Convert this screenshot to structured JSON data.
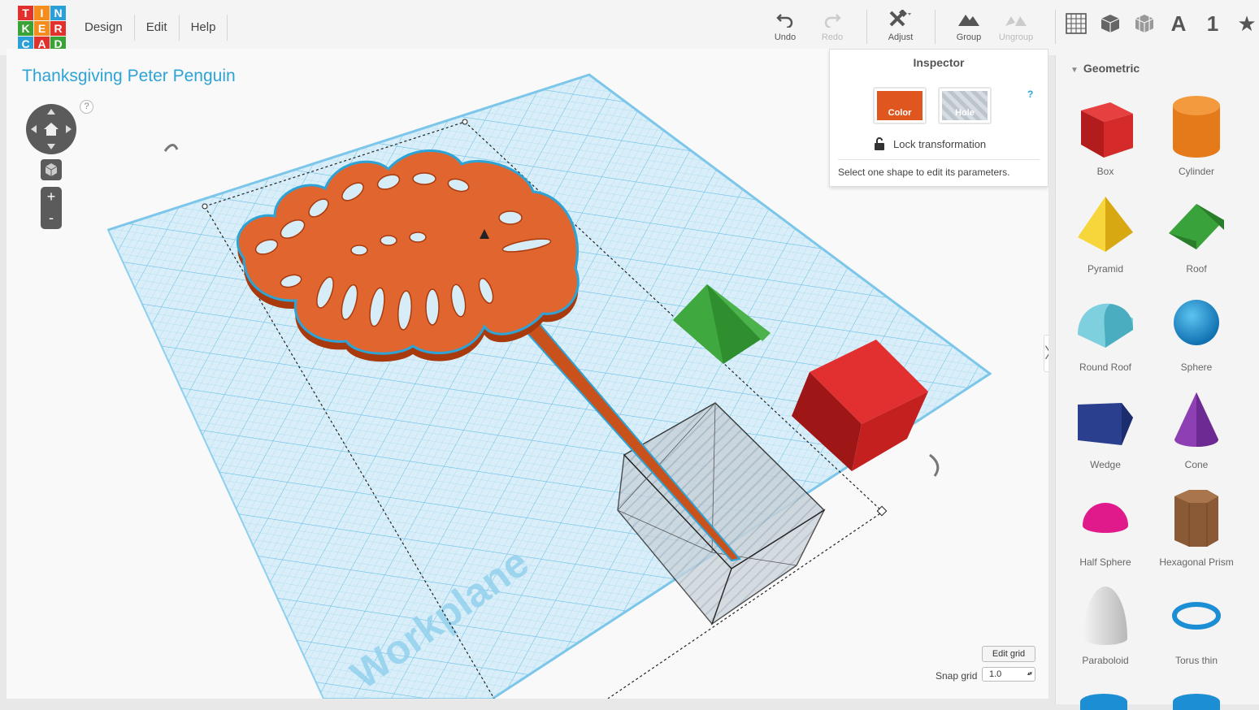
{
  "app": {
    "logo_letters": [
      "T",
      "I",
      "N",
      "K",
      "E",
      "R",
      "C",
      "A",
      "D"
    ],
    "logo_colors": [
      "#e2312c",
      "#f48c1e",
      "#2a9fd8",
      "#3aa335",
      "#f48c1e",
      "#e2312c",
      "#2a9fd8",
      "#e2312c",
      "#3aa335"
    ]
  },
  "menu": [
    {
      "label": "Design"
    },
    {
      "label": "Edit"
    },
    {
      "label": "Help"
    }
  ],
  "toolbar": {
    "undo": "Undo",
    "redo": "Redo",
    "adjust": "Adjust",
    "group": "Group",
    "ungroup": "Ungroup"
  },
  "view_icons": [
    "grid-icon",
    "solid-box-icon",
    "wireframe-box-icon",
    "A",
    "1",
    "★"
  ],
  "design_title": "Thanksgiving Peter Penguin",
  "help_mark": "?",
  "zoom": {
    "plus": "+",
    "minus": "-"
  },
  "inspector": {
    "title": "Inspector",
    "color_label": "Color",
    "hole_label": "Hole",
    "help": "?",
    "lock_label": "Lock transformation",
    "message": "Select one shape to edit its parameters.",
    "color_value": "#e0561f"
  },
  "workplane_text": "Workplane",
  "grid_controls": {
    "edit_grid": "Edit grid",
    "snap_label": "Snap grid",
    "snap_value": "1.0"
  },
  "shapes_panel": {
    "category": "Geometric",
    "items": [
      {
        "label": "Box",
        "color": "#d42a2a"
      },
      {
        "label": "Cylinder",
        "color": "#e47a1a"
      },
      {
        "label": "Pyramid",
        "color": "#f2c51d"
      },
      {
        "label": "Roof",
        "color": "#3aa23a"
      },
      {
        "label": "Round Roof",
        "color": "#5fc0d0"
      },
      {
        "label": "Sphere",
        "color": "#1c8ed4"
      },
      {
        "label": "Wedge",
        "color": "#2a3f8e"
      },
      {
        "label": "Cone",
        "color": "#8e3fb4"
      },
      {
        "label": "Half Sphere",
        "color": "#e01a8a"
      },
      {
        "label": "Hexagonal Prism",
        "color": "#8a5a36"
      },
      {
        "label": "Paraboloid",
        "color": "#dcdcdc"
      },
      {
        "label": "Torus thin",
        "color": "#1c8ed4"
      }
    ]
  }
}
